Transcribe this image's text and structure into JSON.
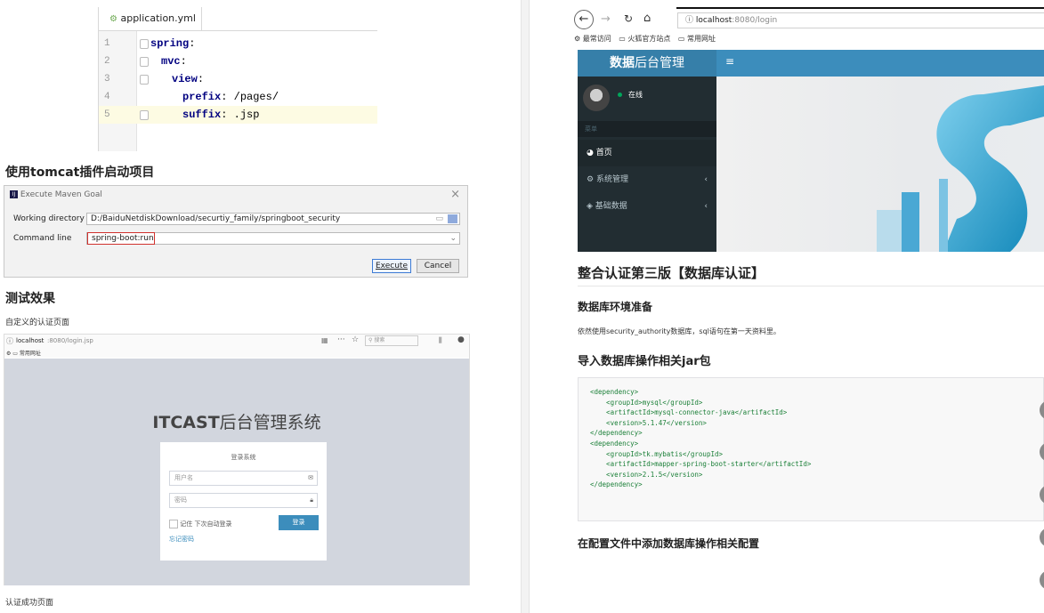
{
  "yaml_editor": {
    "tab_name": "application.yml",
    "lines": [
      {
        "num": "1",
        "indent": 0,
        "key": "spring",
        "value": ""
      },
      {
        "num": "2",
        "indent": 1,
        "key": "mvc",
        "value": ""
      },
      {
        "num": "3",
        "indent": 2,
        "key": "view",
        "value": ""
      },
      {
        "num": "4",
        "indent": 3,
        "key": "prefix",
        "value": " /pages/"
      },
      {
        "num": "5",
        "indent": 3,
        "key": "suffix",
        "value": " .jsp"
      }
    ]
  },
  "left": {
    "heading_tomcat": "使用tomcat插件启动项目",
    "heading_test": "测试效果",
    "caption_custom": "自定义的认证页面",
    "caption_success": "认证成功页面"
  },
  "maven_dialog": {
    "title": "Execute Maven Goal",
    "working_dir_label": "Working directory",
    "working_dir_value": "D:/BaiduNetdiskDownload/securtiy_family/springboot_security",
    "command_label": "Command line",
    "command_value": "spring-boot:run",
    "execute_label": "Execute",
    "cancel_label": "Cancel"
  },
  "login_shot": {
    "url_host": "localhost",
    "url_rest": ":8080/login.jsp",
    "search_placeholder": "搜索",
    "bookmark": "常用网址",
    "brand_bold": "ITCAST",
    "brand_rest": "后台管理系统",
    "box_title": "登录系统",
    "username_placeholder": "用户名",
    "password_placeholder": "密码",
    "remember_label": "记住 下次自动登录",
    "login_button": "登录",
    "forgot_link": "忘记密码"
  },
  "admin_shot": {
    "url_host": "localhost",
    "url_rest": ":8080/login",
    "bookmarks": [
      "最常访问",
      "火狐官方站点",
      "常用网址"
    ],
    "brand_bold": "数据",
    "brand_rest": "后台管理",
    "online_label": "在线",
    "menu_header": "菜单",
    "menu_items": [
      "首页",
      "系统管理",
      "基础数据"
    ]
  },
  "right": {
    "heading_main": "整合认证第三版【数据库认证】",
    "heading_env": "数据库环境准备",
    "env_text": "依然使用security_authority数据库，sql语句在第一天资料里。",
    "heading_jar": "导入数据库操作相关jar包",
    "heading_config": "在配置文件中添加数据库操作相关配置",
    "code_lines": [
      "<dependency>",
      "    <groupId>mysql</groupId>",
      "    <artifactId>mysql-connector-java</artifactId>",
      "    <version>5.1.47</version>",
      "</dependency>",
      "<dependency>",
      "    <groupId>tk.mybatis</groupId>",
      "    <artifactId>mapper-spring-boot-starter</artifactId>",
      "    <version>2.1.5</version>",
      "</dependency>"
    ]
  }
}
